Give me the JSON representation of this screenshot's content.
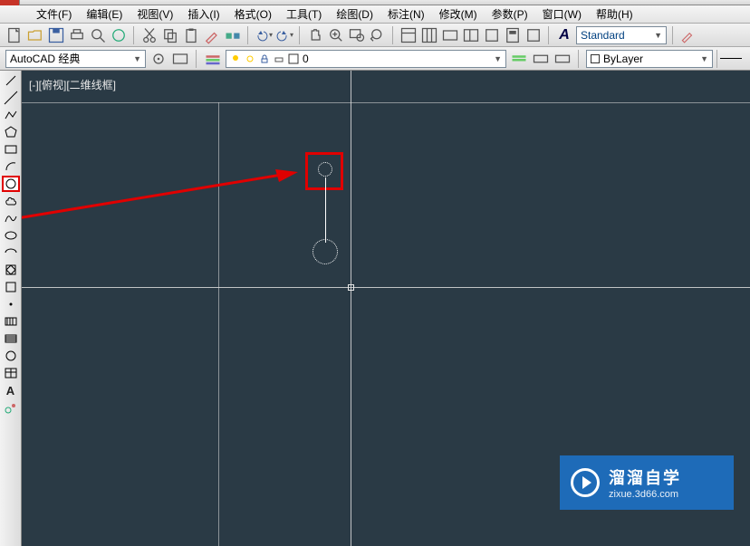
{
  "menu": {
    "file": "文件(F)",
    "edit": "编辑(E)",
    "view": "视图(V)",
    "insert": "插入(I)",
    "format": "格式(O)",
    "tools": "工具(T)",
    "draw": "绘图(D)",
    "dimension": "标注(N)",
    "modify": "修改(M)",
    "param": "参数(P)",
    "window": "窗口(W)",
    "help": "帮助(H)"
  },
  "style": {
    "name": "Standard"
  },
  "workspace": {
    "name": "AutoCAD 经典"
  },
  "layer": {
    "current": "0"
  },
  "bylayer": {
    "label": "ByLayer"
  },
  "viewport": {
    "label": "[-][俯视][二维线框]"
  },
  "watermark": {
    "title": "溜溜自学",
    "url": "zixue.3d66.com"
  }
}
